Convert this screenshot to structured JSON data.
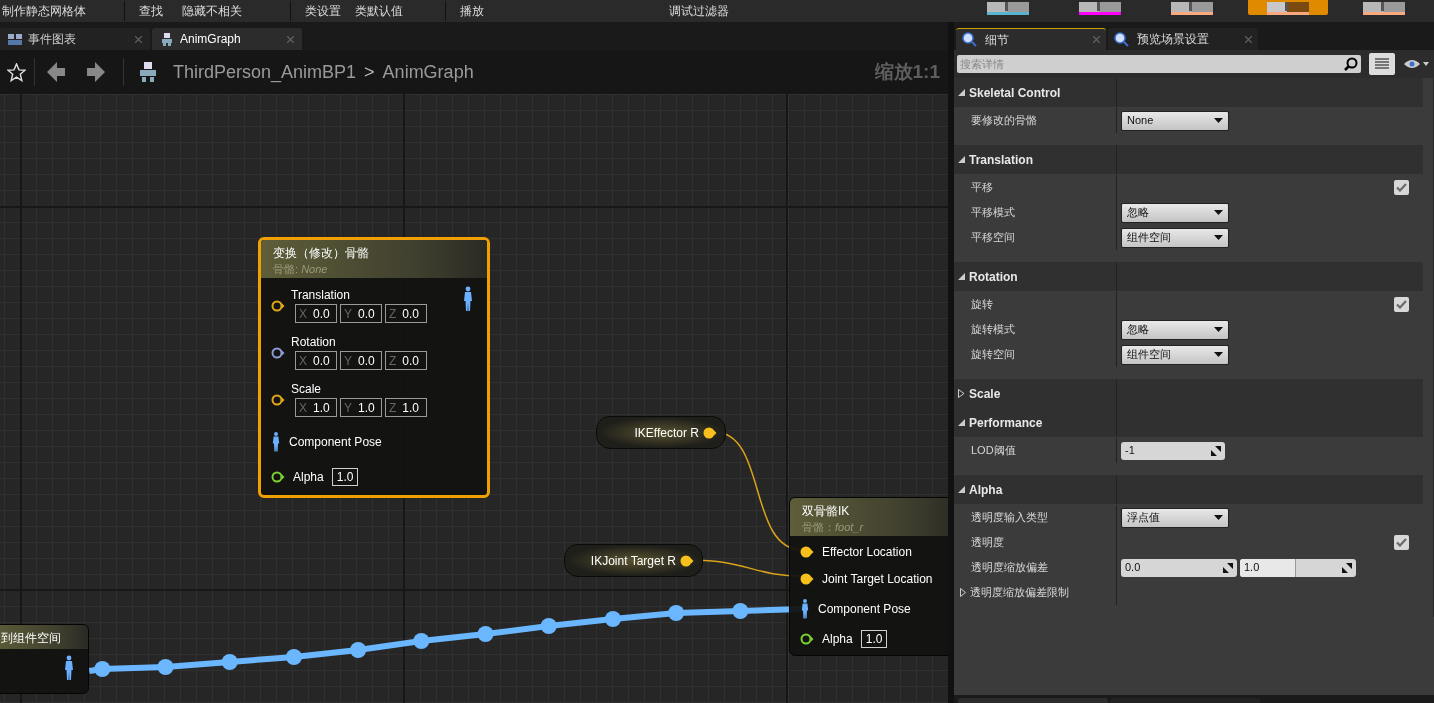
{
  "toolbar": {
    "items": [
      {
        "label": "制作静态网格体"
      },
      {
        "label": "查找"
      },
      {
        "label": "隐藏不相关"
      },
      {
        "label": "类设置"
      },
      {
        "label": "类默认值"
      },
      {
        "label": "播放"
      },
      {
        "label": "调试过滤器"
      }
    ],
    "view_modes": [
      {
        "color": "#5ab4d0",
        "selected": false
      },
      {
        "color": "#ff00ff",
        "selected": false
      },
      {
        "color": "#f9a97f",
        "selected": false
      },
      {
        "color": "#f9a97f",
        "selected": true
      },
      {
        "color": "#f9a97f",
        "selected": false
      }
    ]
  },
  "graph_tabs": [
    {
      "label": "事件图表",
      "selected": false,
      "kind": "event"
    },
    {
      "label": "AnimGraph",
      "selected": true,
      "kind": "anim"
    }
  ],
  "breadcrumb": {
    "path": [
      "ThirdPerson_AnimBP1",
      "AnimGraph"
    ],
    "separator": ">",
    "zoom": "缩放1:1"
  },
  "graph": {
    "nodes": [
      {
        "kind": "function",
        "title": "到组件空间",
        "selected": false,
        "outputs": [
          {
            "kind": "pose"
          }
        ]
      },
      {
        "kind": "function",
        "title": "变换（修改）骨骼",
        "subtitle": "骨骼: *None*",
        "selected": true,
        "outputs": [
          {
            "kind": "pose"
          }
        ],
        "pins": [
          {
            "kind": "vector",
            "label": "Translation",
            "color": "#e5a71a",
            "connected": false,
            "fields": [
              {
                "axis": "X",
                "value": "0.0"
              },
              {
                "axis": "Y",
                "value": "0.0"
              },
              {
                "axis": "Z",
                "value": "0.0"
              }
            ]
          },
          {
            "kind": "vector",
            "label": "Rotation",
            "color": "#8e9bd9",
            "connected": false,
            "fields": [
              {
                "axis": "X",
                "value": "0.0"
              },
              {
                "axis": "Y",
                "value": "0.0"
              },
              {
                "axis": "Z",
                "value": "0.0"
              }
            ]
          },
          {
            "kind": "vector",
            "label": "Scale",
            "color": "#e5a71a",
            "connected": false,
            "fields": [
              {
                "axis": "X",
                "value": "1.0"
              },
              {
                "axis": "Y",
                "value": "1.0"
              },
              {
                "axis": "Z",
                "value": "1.0"
              }
            ]
          },
          {
            "kind": "pose",
            "label": "Component Pose"
          },
          {
            "kind": "float",
            "label": "Alpha",
            "color": "#7bd12e",
            "connected": false,
            "value": "1.0"
          }
        ]
      },
      {
        "kind": "variable",
        "title": "IKEffector R",
        "selected": false,
        "outputs": [
          {
            "kind": "vector",
            "color": "#f7c01c",
            "connected": true
          }
        ]
      },
      {
        "kind": "variable",
        "title": "IKJoint Target R",
        "selected": false,
        "outputs": [
          {
            "kind": "vector",
            "color": "#f7c01c",
            "connected": true
          }
        ]
      },
      {
        "kind": "function",
        "title": "双骨骼IK",
        "subtitle": "骨骼：*foot_r*",
        "selected": false,
        "pins": [
          {
            "kind": "vector",
            "label": "Effector Location",
            "color": "#f7c01c",
            "connected": true
          },
          {
            "kind": "vector",
            "label": "Joint Target Location",
            "color": "#f7c01c",
            "connected": true
          },
          {
            "kind": "pose",
            "label": "Component Pose"
          },
          {
            "kind": "float",
            "label": "Alpha",
            "color": "#7bd12e",
            "connected": false,
            "value": "1.0"
          }
        ]
      }
    ]
  },
  "details_tabs": [
    {
      "label": "细节",
      "selected": true
    },
    {
      "label": "预览场景设置",
      "selected": false
    }
  ],
  "details_search": {
    "placeholder": "搜索详情"
  },
  "sections": [
    {
      "title": "Skeletal Control",
      "expanded": true,
      "rows": [
        {
          "kind": "dropdown",
          "label": "要修改的骨骼",
          "value": "None"
        }
      ]
    },
    {
      "title": "Translation",
      "expanded": true,
      "rows": [
        {
          "kind": "check",
          "label": "平移",
          "checked": true
        },
        {
          "kind": "dropdown",
          "label": "平移模式",
          "value": "忽略"
        },
        {
          "kind": "dropdown",
          "label": "平移空间",
          "value": "组件空间"
        }
      ]
    },
    {
      "title": "Rotation",
      "expanded": true,
      "rows": [
        {
          "kind": "check",
          "label": "旋转",
          "checked": true
        },
        {
          "kind": "dropdown",
          "label": "旋转模式",
          "value": "忽略"
        },
        {
          "kind": "dropdown",
          "label": "旋转空间",
          "value": "组件空间"
        }
      ]
    },
    {
      "title": "Scale",
      "expanded": false
    },
    {
      "title": "Performance",
      "expanded": true,
      "rows": [
        {
          "kind": "number",
          "label": "LOD阈值",
          "value": "-1"
        }
      ]
    },
    {
      "title": "Alpha",
      "expanded": true,
      "rows": [
        {
          "kind": "dropdown",
          "label": "透明度输入类型",
          "value": "浮点值"
        },
        {
          "kind": "check",
          "label": "透明度",
          "checked": true
        },
        {
          "kind": "range",
          "label": "透明度缩放偏差",
          "fields": [
            {
              "value": "0.0"
            },
            {
              "value": "1.0",
              "level": 0.48
            }
          ]
        },
        {
          "kind": "group",
          "label": "透明度缩放偏差限制",
          "expanded": false
        }
      ]
    }
  ]
}
